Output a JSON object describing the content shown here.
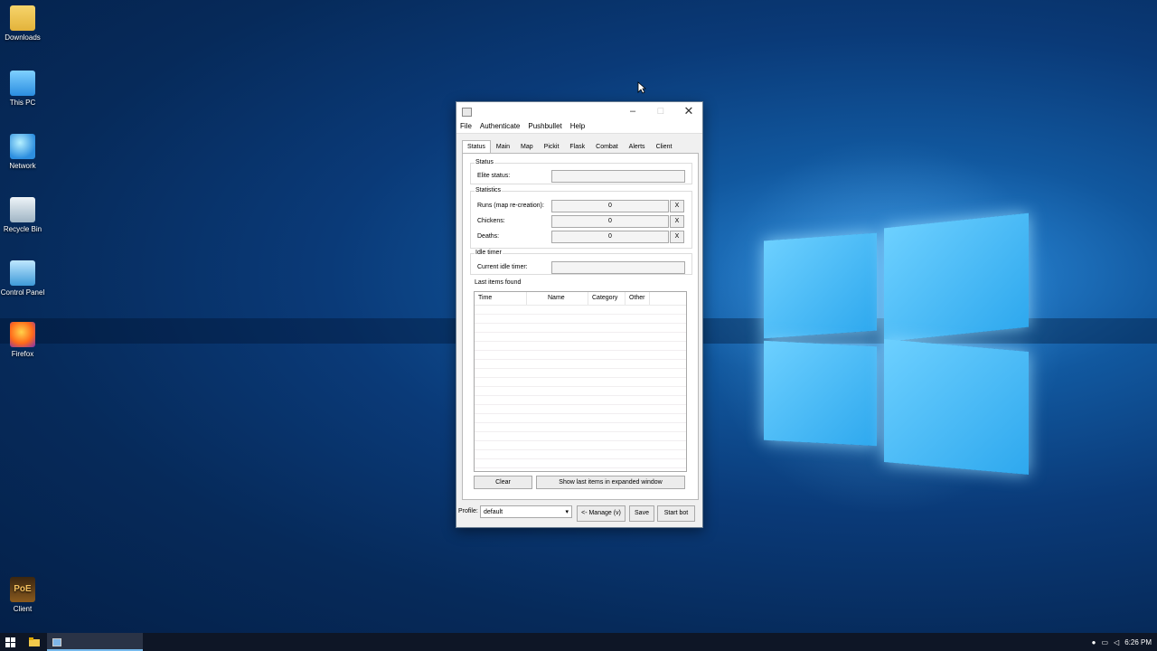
{
  "desktop": {
    "icons": [
      {
        "label": "Downloads",
        "icon": "folder-icon"
      },
      {
        "label": "This PC",
        "icon": "computer-icon"
      },
      {
        "label": "Network",
        "icon": "network-icon"
      },
      {
        "label": "Recycle Bin",
        "icon": "recycle-bin-icon"
      },
      {
        "label": "Control Panel",
        "icon": "control-panel-icon"
      },
      {
        "label": "Firefox",
        "icon": "firefox-icon"
      },
      {
        "label": "Client",
        "icon": "poe-client-icon"
      }
    ],
    "poe_logo_text": "PoE"
  },
  "window": {
    "controls": {
      "minimize": "–",
      "maximize": "□",
      "close": "✕"
    },
    "menu": [
      "File",
      "Authenticate",
      "Pushbullet",
      "Help"
    ],
    "tabs": [
      "Status",
      "Main",
      "Map",
      "Pickit",
      "Flask",
      "Combat",
      "Alerts",
      "Client"
    ],
    "active_tab": "Status",
    "status_section": {
      "heading": "Status",
      "elite_label": "Elite status:",
      "elite_value": ""
    },
    "statistics": {
      "heading": "Statistics",
      "rows": [
        {
          "label": "Runs (map re-creation):",
          "value": "0",
          "reset": "X"
        },
        {
          "label": "Chickens:",
          "value": "0",
          "reset": "X"
        },
        {
          "label": "Deaths:",
          "value": "0",
          "reset": "X"
        }
      ]
    },
    "idle": {
      "heading": "Idle timer",
      "label": "Current idle timer:",
      "value": ""
    },
    "last_items": {
      "heading": "Last items found",
      "columns": [
        "Time",
        "Name",
        "Category",
        "Other"
      ],
      "clear_label": "Clear",
      "expand_label": "Show last items in expanded window"
    },
    "footer": {
      "profile_label": "Profile:",
      "profile_value": "default",
      "manage_label": "<- Manage (v)",
      "save_label": "Save",
      "start_label": "Start bot"
    }
  },
  "taskbar": {
    "start_icon": "windows-start-icon",
    "clock": "6:26 PM"
  },
  "colors": {
    "accent": "#0a64c8",
    "desktop": "#0a3a78",
    "taskbar": "#0e1626"
  }
}
